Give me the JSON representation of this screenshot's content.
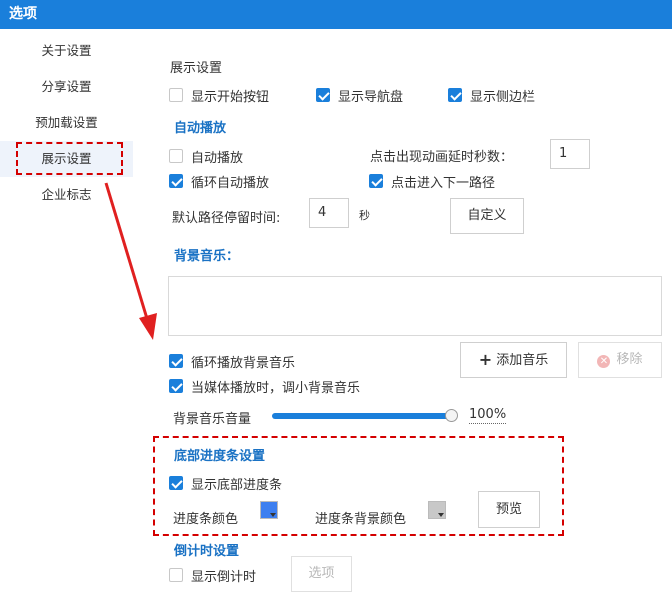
{
  "window": {
    "title": "选项"
  },
  "sidebar": {
    "items": [
      {
        "label": "关于设置"
      },
      {
        "label": "分享设置"
      },
      {
        "label": "预加载设置"
      },
      {
        "label": "展示设置"
      },
      {
        "label": "企业标志"
      }
    ],
    "active_index": 3
  },
  "display": {
    "heading": "展示设置",
    "show_start_button": {
      "label": "显示开始按钮",
      "checked": false
    },
    "show_nav_disk": {
      "label": "显示导航盘",
      "checked": true
    },
    "show_sidebar": {
      "label": "显示侧边栏",
      "checked": true
    }
  },
  "autoplay": {
    "heading": "自动播放",
    "autoplay": {
      "label": "自动播放",
      "checked": false
    },
    "loop_autoplay": {
      "label": "循环自动播放",
      "checked": true
    },
    "click_delay_label": "点击出现动画延时秒数：",
    "click_delay_value": "1",
    "click_next_path": {
      "label": "点击进入下一路径",
      "checked": true
    },
    "default_stay_label": "默认路径停留时间:",
    "default_stay_value": "4",
    "seconds_unit": "秒",
    "custom_button": "自定义"
  },
  "bgmusic": {
    "heading": "背景音乐：",
    "loop_music": {
      "label": "循环播放背景音乐",
      "checked": true
    },
    "lower_on_media": {
      "label": "当媒体播放时，调小背景音乐",
      "checked": true
    },
    "add_button": "添加音乐",
    "remove_button": "移除",
    "volume_label": "背景音乐音量",
    "volume_value": "100%",
    "volume_level": 1.0
  },
  "progress": {
    "heading": "底部进度条设置",
    "show_progress": {
      "label": "显示底部进度条",
      "checked": true
    },
    "bar_color_label": "进度条颜色",
    "bar_color": "#3d7ff0",
    "bar_bg_label": "进度条背景颜色",
    "bar_bg_color": "#c8c8c8",
    "preview_button": "预览"
  },
  "countdown": {
    "heading": "倒计时设置",
    "show_countdown": {
      "label": "显示倒计时",
      "checked": false
    },
    "options_button": "选项"
  },
  "colors": {
    "titlebar": "#1a7fdb",
    "accent": "#1a7fdb",
    "annotation": "#d40000"
  },
  "icons": {
    "add": "plus-icon",
    "remove": "remove-circle-icon",
    "annotation_arrow": "red-arrow-icon"
  }
}
